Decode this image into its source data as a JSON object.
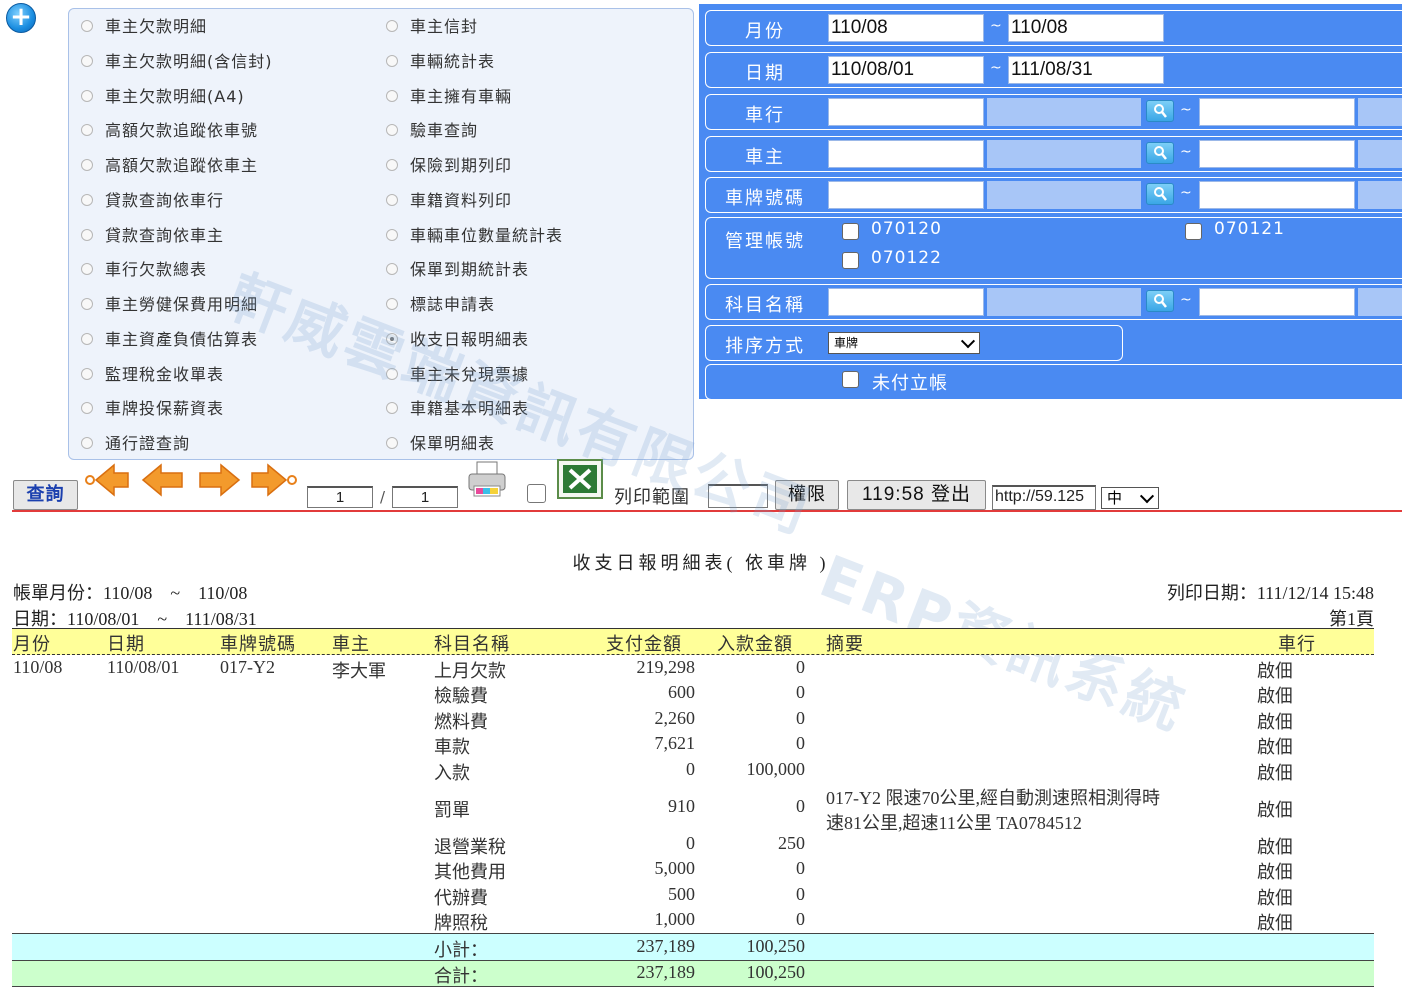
{
  "report_types": [
    {
      "label": "車主欠款明細",
      "selected": false
    },
    {
      "label": "車主欠款明細(含信封)",
      "selected": false
    },
    {
      "label": "車主欠款明細(A4)",
      "selected": false
    },
    {
      "label": "高額欠款追蹤依車號",
      "selected": false
    },
    {
      "label": "高額欠款追蹤依車主",
      "selected": false
    },
    {
      "label": "貸款查詢依車行",
      "selected": false
    },
    {
      "label": "貸款查詢依車主",
      "selected": false
    },
    {
      "label": "車行欠款總表",
      "selected": false
    },
    {
      "label": "車主勞健保費用明細",
      "selected": false
    },
    {
      "label": "車主資產負債估算表",
      "selected": false
    },
    {
      "label": "監理稅金收單表",
      "selected": false
    },
    {
      "label": "車牌投保薪資表",
      "selected": false
    },
    {
      "label": "通行證查詢",
      "selected": false
    },
    {
      "label": "車主信封",
      "selected": false
    },
    {
      "label": "車輛統計表",
      "selected": false
    },
    {
      "label": "車主擁有車輛",
      "selected": false
    },
    {
      "label": "驗車查詢",
      "selected": false
    },
    {
      "label": "保險到期列印",
      "selected": false
    },
    {
      "label": "車籍資料列印",
      "selected": false
    },
    {
      "label": "車輛車位數量統計表",
      "selected": false
    },
    {
      "label": "保單到期統計表",
      "selected": false
    },
    {
      "label": "標誌申請表",
      "selected": false
    },
    {
      "label": "收支日報明細表",
      "selected": true
    },
    {
      "label": "車主未兌現票據",
      "selected": false
    },
    {
      "label": "車籍基本明細表",
      "selected": false
    },
    {
      "label": "保單明細表",
      "selected": false
    }
  ],
  "query": {
    "month_label": "月份",
    "month_from": "110/08",
    "month_to": "110/08",
    "date_label": "日期",
    "date_from": "110/08/01",
    "date_to": "111/08/31",
    "company_label": "車行",
    "owner_label": "車主",
    "plate_label": "車牌號碼",
    "account_label": "管理帳號",
    "accounts": [
      "070120",
      "070121",
      "070122"
    ],
    "subject_label": "科目名稱",
    "sort_label": "排序方式",
    "sort_value": "車牌",
    "unpaid_label": "未付立帳",
    "tilde": "~"
  },
  "toolbar": {
    "query_button": "查詢",
    "page_current": "1",
    "page_slash": "/",
    "page_total": "1",
    "print_range_label": "列印範圍",
    "permission_button": "權限",
    "logout_button": "119:58 登出",
    "url_value": "http://59.125",
    "lang_select": "中"
  },
  "report": {
    "title": "收支日報明細表( 依車牌 )",
    "month_line": "帳單月份：110/08　~　110/08",
    "date_line": "日期：110/08/01　~　111/08/31",
    "print_date": "列印日期：111/12/14 15:48",
    "page_no": "第1頁",
    "headers": {
      "month": "月份",
      "date": "日期",
      "plate": "車牌號碼",
      "owner": "車主",
      "subject": "科目名稱",
      "pay": "支付金額",
      "income": "入款金額",
      "memo": "摘要",
      "company": "車行"
    },
    "group": {
      "month": "110/08",
      "date": "110/08/01",
      "plate": "017-Y2",
      "owner": "李大軍"
    },
    "rows": [
      {
        "subject": "上月欠款",
        "pay": "219,298",
        "income": "0",
        "memo": "",
        "company": "啟佃"
      },
      {
        "subject": "檢驗費",
        "pay": "600",
        "income": "0",
        "memo": "",
        "company": "啟佃"
      },
      {
        "subject": "燃料費",
        "pay": "2,260",
        "income": "0",
        "memo": "",
        "company": "啟佃"
      },
      {
        "subject": "車款",
        "pay": "7,621",
        "income": "0",
        "memo": "",
        "company": "啟佃"
      },
      {
        "subject": "入款",
        "pay": "0",
        "income": "100,000",
        "memo": "",
        "company": "啟佃"
      },
      {
        "subject": "罰單",
        "pay": "910",
        "income": "0",
        "memo_line1": "017-Y2 限速70公里,經自動測速照相測得時",
        "memo_line2": "速81公里,超速11公里 TA0784512",
        "company": "啟佃"
      },
      {
        "subject": "退營業稅",
        "pay": "0",
        "income": "250",
        "memo": "",
        "company": "啟佃"
      },
      {
        "subject": "其他費用",
        "pay": "5,000",
        "income": "0",
        "memo": "",
        "company": "啟佃"
      },
      {
        "subject": "代辦費",
        "pay": "500",
        "income": "0",
        "memo": "",
        "company": "啟佃"
      },
      {
        "subject": "牌照稅",
        "pay": "1,000",
        "income": "0",
        "memo": "",
        "company": "啟佃"
      }
    ],
    "subtotal": {
      "label": "小計：",
      "pay": "237,189",
      "income": "100,250"
    },
    "total": {
      "label": "合計：",
      "pay": "237,189",
      "income": "100,250"
    }
  },
  "watermark": {
    "line1": "軒威雲端資訊有限公司",
    "line2": "ERP資訊系統"
  }
}
